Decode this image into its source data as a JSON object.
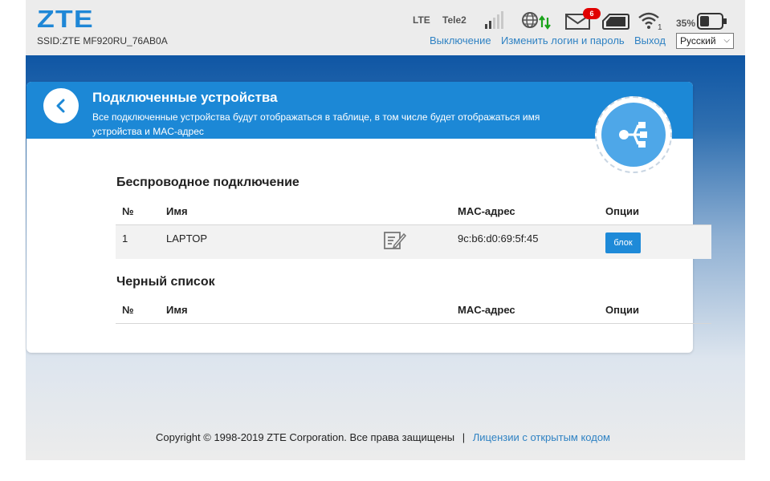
{
  "header": {
    "logo": "ZTE",
    "ssid": "SSID:ZTE MF920RU_76AB0A",
    "network_type": "LTE",
    "operator": "Tele2",
    "messages_count": "6",
    "battery_percent": "35%",
    "links": {
      "shutdown": "Выключение",
      "change_login": "Изменить логин и пароль",
      "logout": "Выход"
    },
    "language": "Русский"
  },
  "card": {
    "title": "Подключенные устройства",
    "description": "Все подключенные устройства будут отображаться в таблице, в том числе будет отображаться имя устройства и MAC-адрес"
  },
  "wireless": {
    "title": "Беспроводное подключение",
    "columns": {
      "no": "№",
      "name": "Имя",
      "mac": "MAC-адрес",
      "options": "Опции"
    },
    "rows": [
      {
        "no": "1",
        "name": "LAPTOP",
        "mac": "9c:b6:d0:69:5f:45",
        "action": "блок"
      }
    ]
  },
  "blacklist": {
    "title": "Черный список",
    "columns": {
      "no": "№",
      "name": "Имя",
      "mac": "MAC-адрес",
      "options": "Опции"
    }
  },
  "footer": {
    "copyright": "Copyright © 1998-2019 ZTE Corporation. Все права защищены",
    "separator": "|",
    "license_link": "Лицензии с открытым кодом"
  },
  "colors": {
    "accent": "#1c88d6",
    "link": "#2f82c3",
    "badge": "#e10000",
    "signal_arrows": "#1aa31a"
  }
}
